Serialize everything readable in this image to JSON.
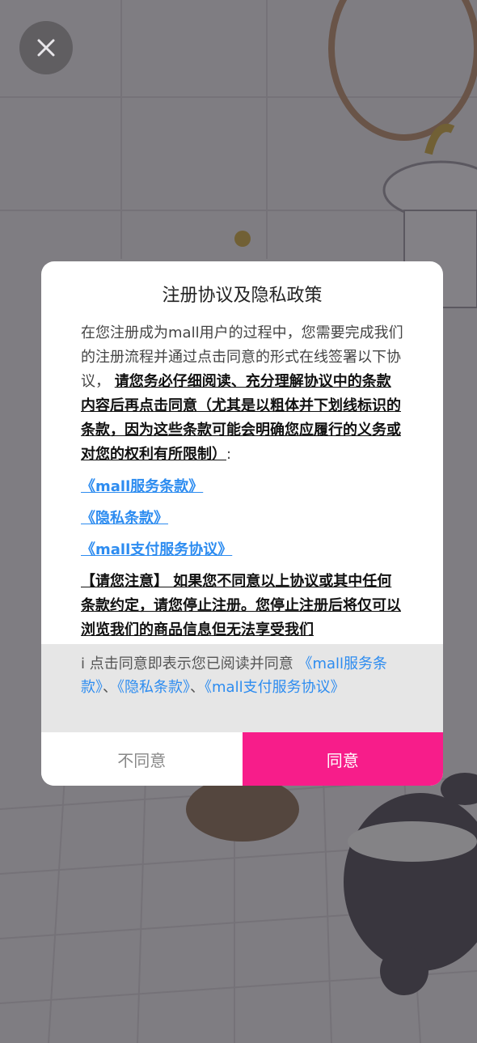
{
  "dialog": {
    "title": "注册协议及隐私政策",
    "intro_plain": "在您注册成为mall用户的过程中，您需要完成我们的注册流程并通过点击同意的形式在线签署以下协议，",
    "intro_bold": "请您务必仔细阅读、充分理解协议中的条款内容后再点击同意（尤其是以粗体并下划线标识的条款，因为这些条款可能会明确您应履行的义务或对您的权利有所限制）",
    "intro_tail": ":",
    "links": [
      "《mall服务条款》",
      "《隐私条款》",
      "《mall支付服务协议》"
    ],
    "notice": "【请您注意】 如果您不同意以上协议或其中任何条款约定，请您停止注册。您停止注册后将仅可以浏览我们的商品信息但无法享受我们"
  },
  "agree_bar": {
    "prefix": "i 点击同意即表示您已阅读并同意 ",
    "link_service": "《mall服务条款》",
    "sep1": "、",
    "link_privacy": "《隐私条款》",
    "sep2": "、",
    "link_payment": "《mall支付服务协议》"
  },
  "buttons": {
    "disagree": "不同意",
    "agree": "同意"
  },
  "icons": {
    "close": "close-icon"
  },
  "colors": {
    "accent": "#f71d8a",
    "link": "#2d8cf0"
  }
}
